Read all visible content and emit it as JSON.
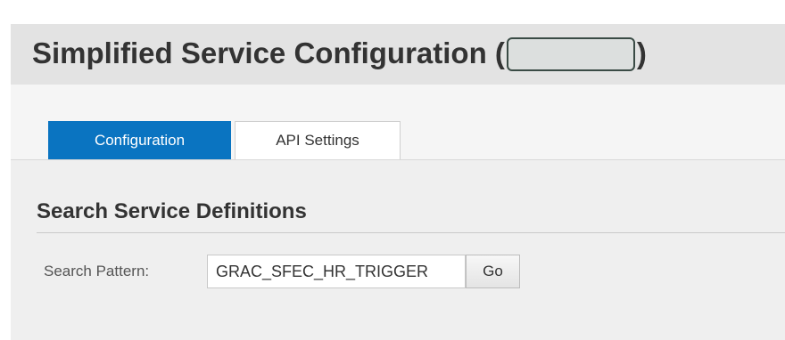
{
  "header": {
    "title": "Simplified Service Configuration",
    "open_paren": "(",
    "close_paren": ")"
  },
  "tabs": [
    {
      "label": "Configuration",
      "active": true
    },
    {
      "label": "API Settings",
      "active": false
    }
  ],
  "section": {
    "title": "Search Service Definitions"
  },
  "search": {
    "label": "Search Pattern:",
    "value": "GRAC_SFEC_HR_TRIGGER",
    "button_label": "Go"
  },
  "colors": {
    "active_tab": "#0a74c1",
    "header_bg": "#e3e3e3"
  }
}
